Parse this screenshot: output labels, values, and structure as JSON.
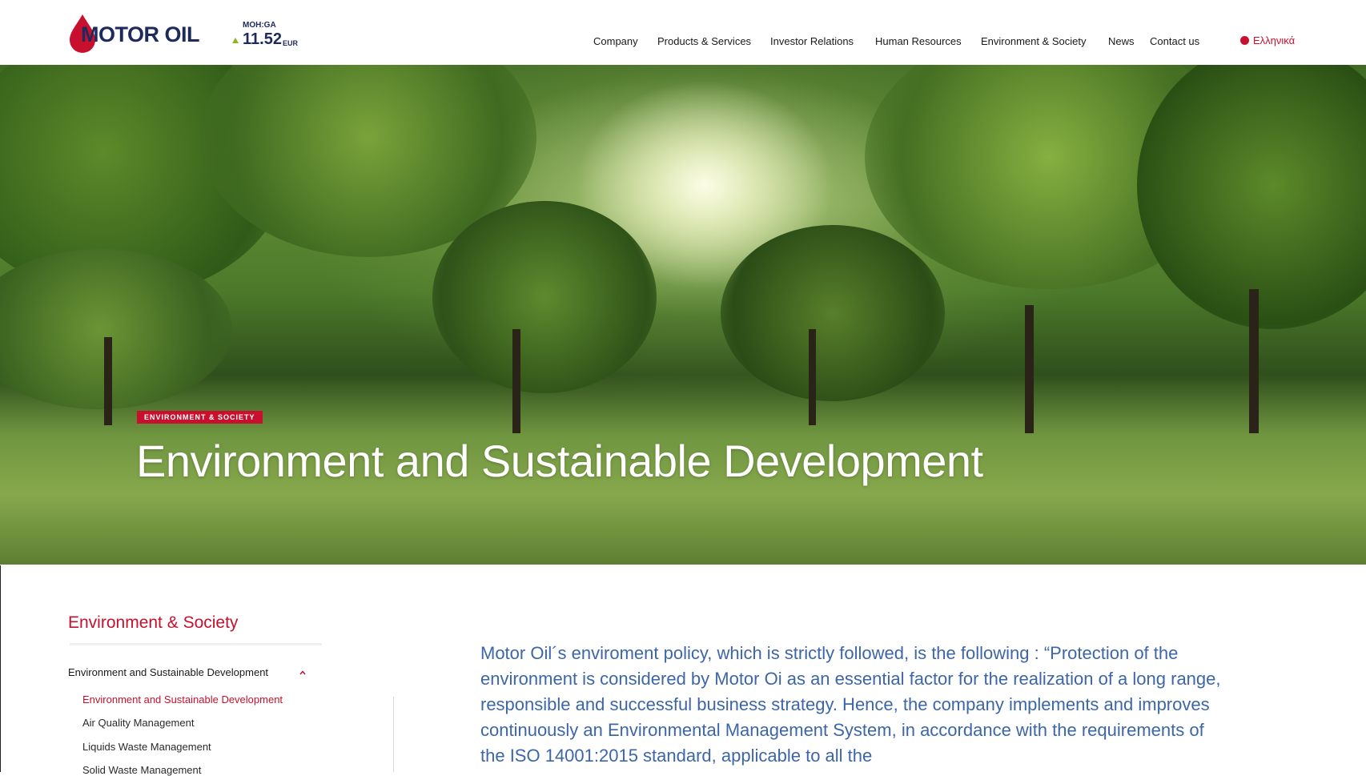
{
  "header": {
    "logo_text": "MOTOR OIL",
    "stock": {
      "ticker": "MOH:GA",
      "price": "11.52",
      "currency": "EUR",
      "trend": "up"
    },
    "nav": [
      "Company",
      "Products & Services",
      "Investor Relations",
      "Human Resources",
      "Environment & Society",
      "News",
      "Contact us"
    ],
    "language": "Ελληνικά"
  },
  "hero": {
    "tag": "ENVIRONMENT & SOCIETY",
    "title": "Environment and Sustainable Development"
  },
  "sidebar": {
    "title": "Environment & Society",
    "parent": "Environment and Sustainable Development",
    "children": [
      {
        "label": "Environment and Sustainable Development",
        "active": true
      },
      {
        "label": "Air Quality Management",
        "active": false
      },
      {
        "label": "Liquids Waste Management",
        "active": false
      },
      {
        "label": "Solid Waste Management",
        "active": false
      }
    ]
  },
  "content": {
    "intro": "Motor Oil´s enviroment policy, which is strictly followed, is the following : “Protection of the environment is considered by Motor Oi as an essential factor for the realization of a long range, responsible and successful business strategy. Hence, the company implements and improves continuously an Environmental Management System, in accordance with the requirements of the ISO 14001:2015 standard, applicable to all the"
  },
  "colors": {
    "brand_red": "#c8102e",
    "brand_navy": "#1d2a5b",
    "intro_blue": "#3d66a8",
    "stock_up": "#8fb324"
  }
}
